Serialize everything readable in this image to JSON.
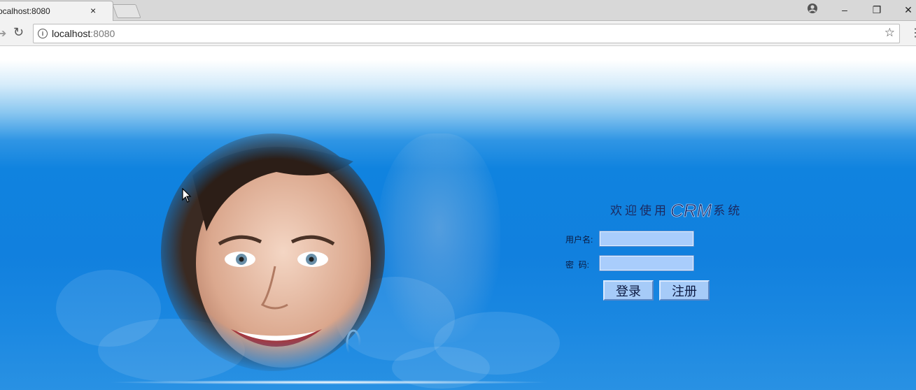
{
  "browser": {
    "tab_title": "ocalhost:8080",
    "tab_close": "×",
    "url_host": "localhost",
    "url_port": ":8080"
  },
  "window_controls": {
    "minimize": "–",
    "restore": "❐",
    "close": "✕",
    "account": "●"
  },
  "login": {
    "welcome_prefix": "欢迎使用",
    "welcome_brand": "CRM",
    "welcome_suffix": "系统",
    "username_label": "用户名:",
    "username_value": "",
    "password_label": "密  码:",
    "password_value": "",
    "login_button": "登录",
    "register_button": "注册"
  },
  "colors": {
    "page_blue": "#1180de",
    "field_fill": "#a9cdfc",
    "button_fill": "#a6cbf8",
    "title_text": "#1c2a60"
  }
}
